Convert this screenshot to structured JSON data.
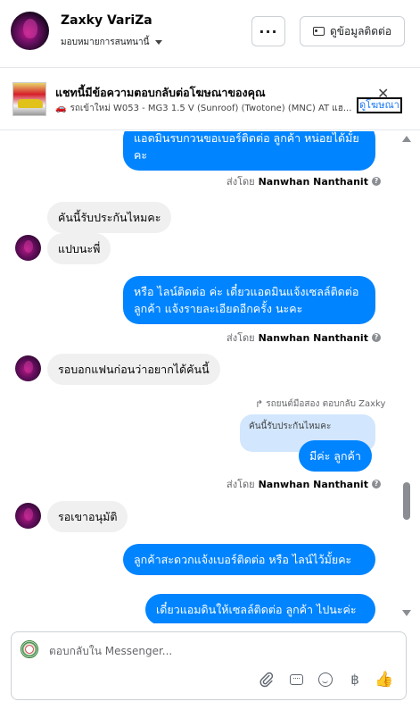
{
  "header": {
    "contact_name": "Zaxky VariZa",
    "assign_label": "มอบหมายการสนทนานี้",
    "more_label": "···",
    "profile_button": "ดูข้อมูลติดต่อ"
  },
  "ad_banner": {
    "title": "แชทนี้มีข้อความตอบกลับต่อโฆษณาของคุณ",
    "subtitle": "รถเข้าใหม่ W053 - MG3 1.5 V (Sunroof) (Twotone) (MNC) AT แฮ...",
    "link": "ดูโฆษณา"
  },
  "messages": {
    "m1": "แอดมินรบกวนขอเบอร์ติดต่อ ลูกค้า หน่อยได้มั้ยคะ",
    "sent_by_1": "ส่งโดย",
    "agent_1": "Nanwhan Nanthanit",
    "in1": "คันนี้รับประกันไหมคะ",
    "in2": "แปบนะพี่",
    "m2": "หรือ ไลน์ติดต่อ ค่ะ  เดี๋ยวแอดมินแจ้งเซลล์ติดต่อ ลูกค้า  แจ้งรายละเอียดอีกครั้ง นะคะ",
    "sent_by_2": "ส่งโดย",
    "agent_2": "Nanwhan Nanthanit",
    "in3": "รอบอกแฟนก่อนว่าอยากได้คันนี้",
    "reply_meta": "รถยนต์มือสอง ตอบกลับ Zaxky",
    "quoted": "คันนี้รับประกันไหมคะ",
    "m3": "มีค่ะ  ลูกค้า",
    "sent_by_3": "ส่งโดย",
    "agent_3": "Nanwhan Nanthanit",
    "in4": "รอเขาอนุมัติ",
    "m4": "ลูกค้าสะดวกแจ้งเบอร์ติดต่อ หรือ ไลน์ไว้มั้ยคะ",
    "m5": "เดี๋ยวแอมดินให้เซลล์ติดต่อ ลูกค้า ไปนะค่ะ"
  },
  "composer": {
    "placeholder": "ตอบกลับใน Messenger..."
  },
  "icons": [
    "caret-down-icon",
    "id-card-icon",
    "car-icon",
    "close-icon",
    "reply-arrow-icon",
    "info-icon",
    "attachment-icon",
    "saved-reply-icon",
    "emoji-icon",
    "baht-icon",
    "like-icon"
  ],
  "colors": {
    "outgoing": "#0084ff",
    "incoming": "#f0f0f0",
    "link": "#1877f2"
  }
}
